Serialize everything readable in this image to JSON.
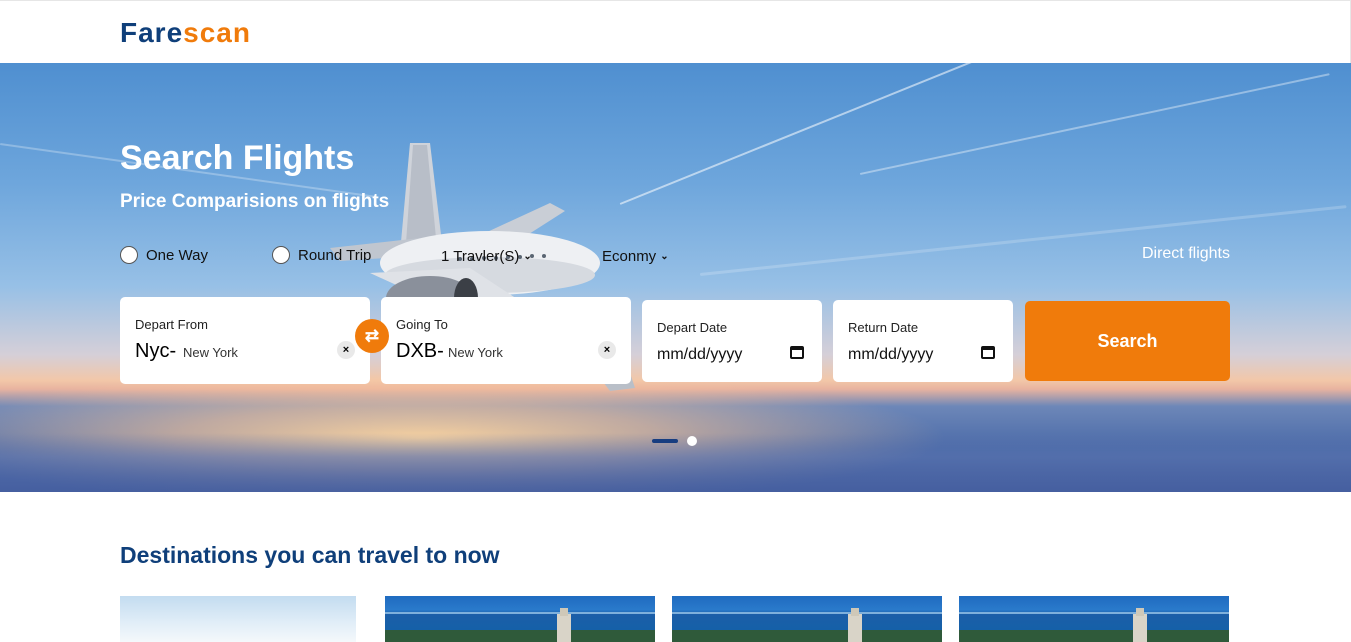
{
  "brand": {
    "part1": "Fare",
    "part2": "scan"
  },
  "hero": {
    "title": "Search Flights",
    "subtitle": "Price Comparisions on flights"
  },
  "trip_options": {
    "one_way": "One Way",
    "round_trip": "Round Trip",
    "travelers": "1 Travler(S)",
    "cabin": "Econmy",
    "direct_flights": "Direct flights"
  },
  "form": {
    "from": {
      "label": "Depart From",
      "code": "Nyc-",
      "city": "New York"
    },
    "to": {
      "label": "Going To",
      "code": "DXB-",
      "city": "New York"
    },
    "depart_date": {
      "label": "Depart Date",
      "placeholder": "mm/dd/yyyy"
    },
    "return_date": {
      "label": "Return Date",
      "placeholder": "mm/dd/yyyy"
    },
    "search_label": "Search",
    "clear_glyph": "×",
    "swap_glyph": "⇄"
  },
  "carousel": {
    "slides": 2,
    "active": 1
  },
  "destinations": {
    "title": "Destinations you can travel to now"
  },
  "colors": {
    "brand_blue": "#0f3f7a",
    "accent_orange": "#f07b0b"
  },
  "icons": [
    "swap-icon",
    "clear-icon",
    "calendar-icon",
    "chevron-down-icon"
  ]
}
